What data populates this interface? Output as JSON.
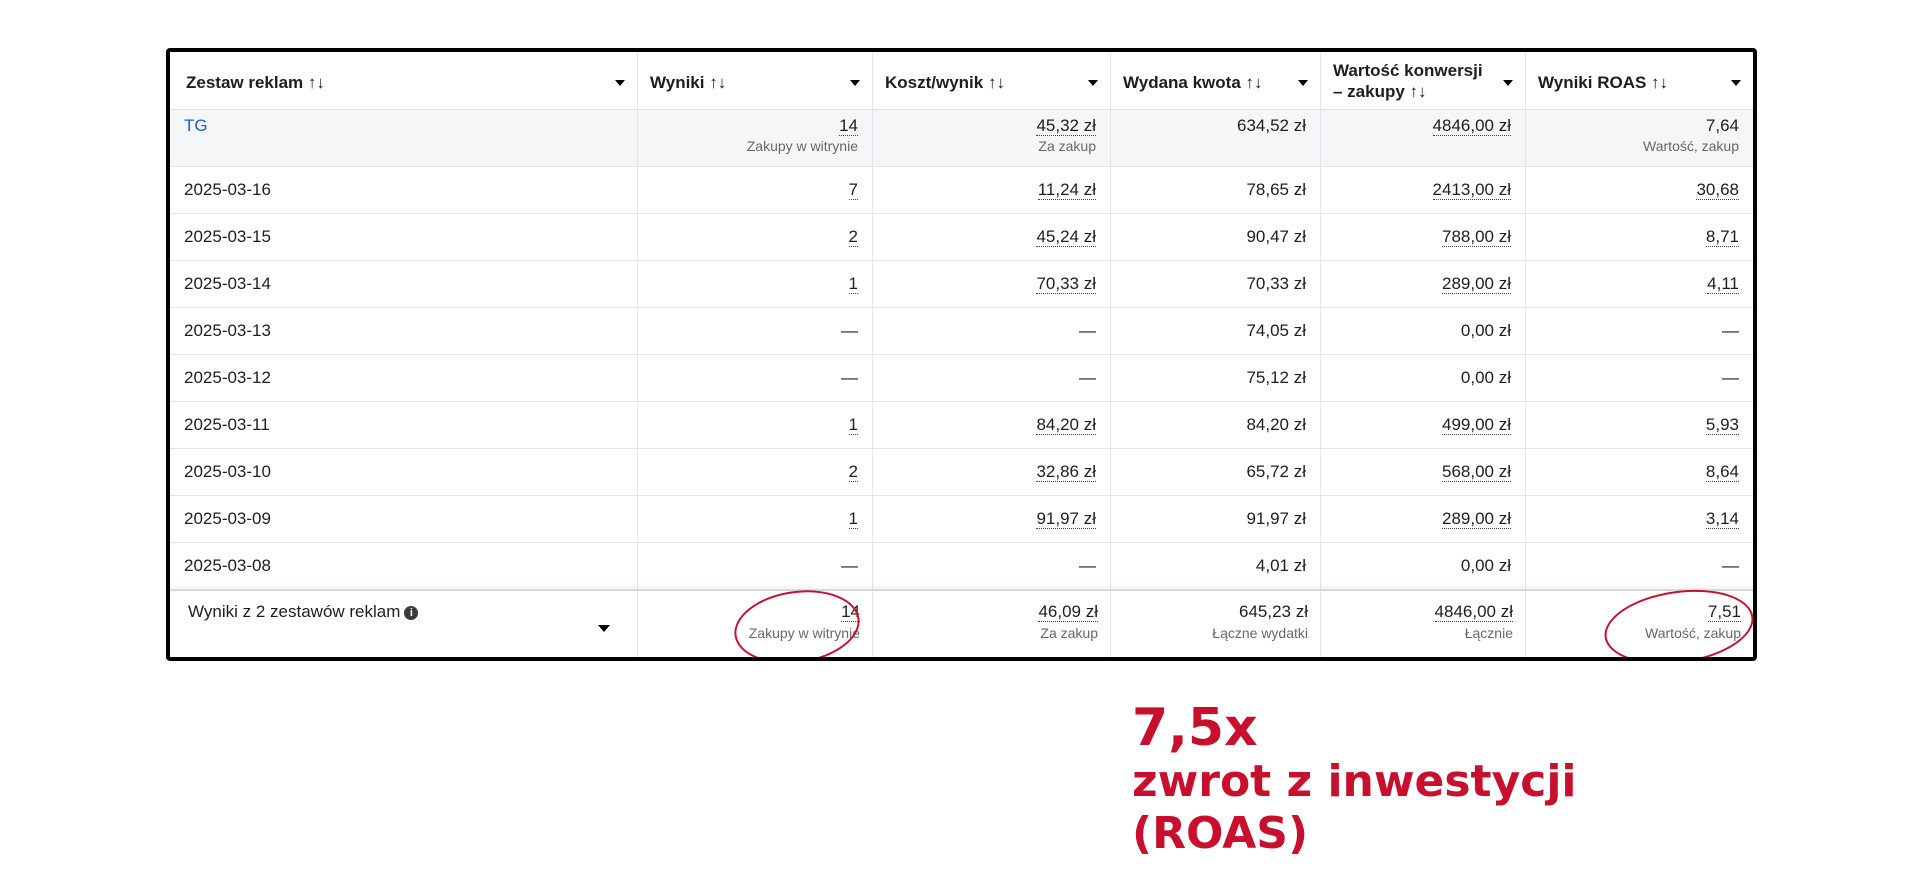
{
  "headers": {
    "col1": "Zestaw reklam ↑↓",
    "col2": "Wyniki ↑↓",
    "col3": "Koszt/wynik ↑↓",
    "col4": "Wydana kwota ↑↓",
    "col5": "Wartość konwersji – zakupy ↑↓",
    "col6": "Wyniki ROAS ↑↓"
  },
  "tg": {
    "name": "TG",
    "results": "14",
    "results_sub": "Zakupy w witrynie",
    "cost": "45,32 zł",
    "cost_sub": "Za zakup",
    "spent": "634,52 zł",
    "value": "4846,00 zł",
    "roas": "7,64",
    "roas_sub": "Wartość, zakup"
  },
  "rows": [
    {
      "date": "2025-03-16",
      "results": "7",
      "cost": "11,24 zł",
      "spent": "78,65 zł",
      "value": "2413,00 zł",
      "roas": "30,68"
    },
    {
      "date": "2025-03-15",
      "results": "2",
      "cost": "45,24 zł",
      "spent": "90,47 zł",
      "value": "788,00 zł",
      "roas": "8,71"
    },
    {
      "date": "2025-03-14",
      "results": "1",
      "cost": "70,33 zł",
      "spent": "70,33 zł",
      "value": "289,00 zł",
      "roas": "4,11"
    },
    {
      "date": "2025-03-13",
      "results": "—",
      "cost": "—",
      "spent": "74,05 zł",
      "value": "0,00 zł",
      "roas": "—"
    },
    {
      "date": "2025-03-12",
      "results": "—",
      "cost": "—",
      "spent": "75,12 zł",
      "value": "0,00 zł",
      "roas": "—"
    },
    {
      "date": "2025-03-11",
      "results": "1",
      "cost": "84,20 zł",
      "spent": "84,20 zł",
      "value": "499,00 zł",
      "roas": "5,93"
    },
    {
      "date": "2025-03-10",
      "results": "2",
      "cost": "32,86 zł",
      "spent": "65,72 zł",
      "value": "568,00 zł",
      "roas": "8,64"
    },
    {
      "date": "2025-03-09",
      "results": "1",
      "cost": "91,97 zł",
      "spent": "91,97 zł",
      "value": "289,00 zł",
      "roas": "3,14"
    },
    {
      "date": "2025-03-08",
      "results": "—",
      "cost": "—",
      "spent": "4,01 zł",
      "value": "0,00 zł",
      "roas": "—"
    }
  ],
  "footer": {
    "label": "Wyniki z 2 zestawów reklam",
    "results": "14",
    "results_sub": "Zakupy w witrynie",
    "cost": "46,09 zł",
    "cost_sub": "Za zakup",
    "spent": "645,23 zł",
    "spent_sub": "Łączne wydatki",
    "value": "4846,00 zł",
    "value_sub": "Łącznie",
    "roas": "7,51",
    "roas_sub": "Wartość, zakup"
  },
  "headline": {
    "big": "7,5x",
    "line1": "zwrot z inwestycji",
    "line2": "(ROAS)"
  },
  "colors": {
    "accent": "#c8102e",
    "link": "#1a5fd6"
  }
}
